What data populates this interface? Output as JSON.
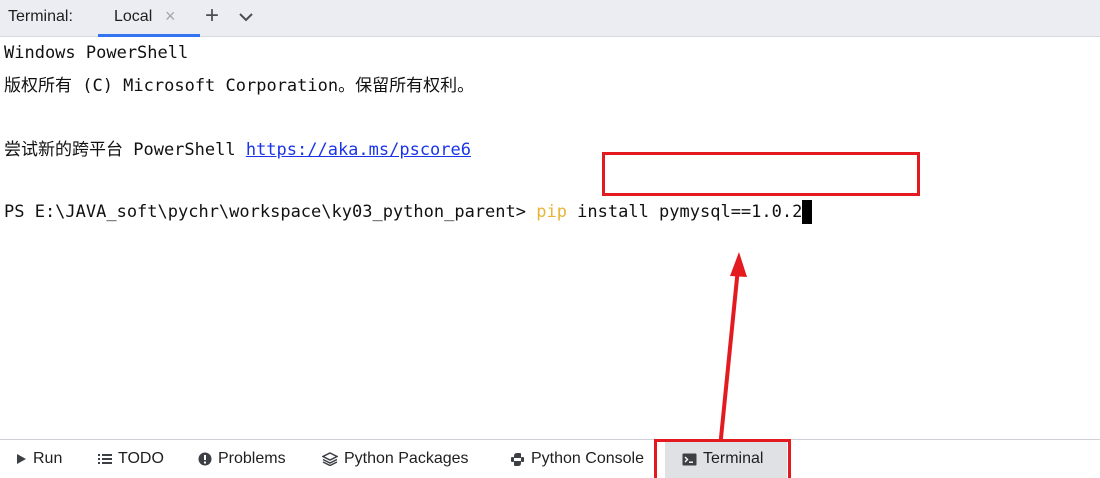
{
  "header": {
    "title": "Terminal:",
    "tab_label": "Local",
    "tab_close": "×",
    "add_tab": "+"
  },
  "terminal": {
    "line1": "Windows PowerShell",
    "line2": "版权所有 (C) Microsoft Corporation。保留所有权利。",
    "line3_prefix": "尝试新的跨平台 PowerShell ",
    "line3_link": "https://aka.ms/pscore6",
    "prompt": "PS E:\\JAVA_soft\\pychr\\workspace\\ky03_python_parent> ",
    "command_pip": "pip",
    "command_rest": " install pymysql==1.0.2"
  },
  "toolbar": {
    "run": "Run",
    "todo": "TODO",
    "problems": "Problems",
    "python_packages": "Python Packages",
    "python_console": "Python Console",
    "terminal": "Terminal"
  },
  "colors": {
    "accent_tab": "#3574f0",
    "annotation_red": "#e31a1f",
    "link": "#1a35e8",
    "pip_keyword": "#e7b533"
  }
}
